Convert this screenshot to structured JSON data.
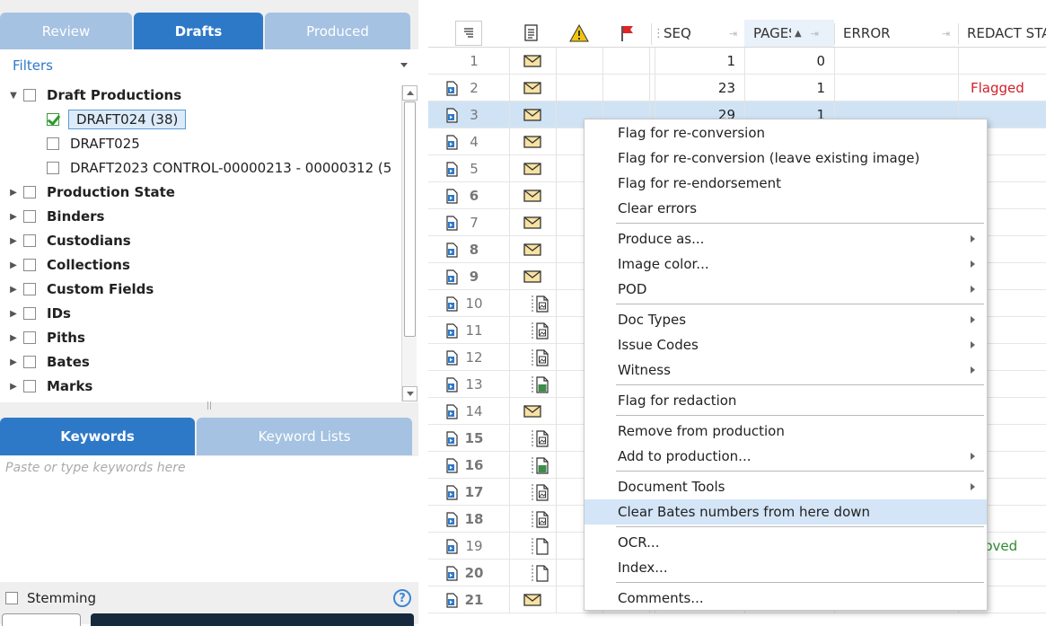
{
  "left_tabs": [
    {
      "label": "Review",
      "active": false
    },
    {
      "label": "Drafts",
      "active": true
    },
    {
      "label": "Produced",
      "active": false
    }
  ],
  "filters": {
    "label": "Filters",
    "tree": [
      {
        "label": "Draft Productions",
        "bold": true,
        "expander": "open",
        "checked": false
      },
      {
        "label": "DRAFT024 (38)",
        "bold": false,
        "checked": true,
        "selected": true
      },
      {
        "label": "DRAFT025",
        "bold": false,
        "checked": false
      },
      {
        "label": "DRAFT2023 CONTROL-00000213 - 00000312 (5",
        "bold": false,
        "checked": false
      },
      {
        "label": "Production State",
        "bold": true,
        "expander": "closed",
        "checked": false
      },
      {
        "label": "Binders",
        "bold": true,
        "expander": "closed",
        "checked": false
      },
      {
        "label": "Custodians",
        "bold": true,
        "expander": "closed",
        "checked": false
      },
      {
        "label": "Collections",
        "bold": true,
        "expander": "closed",
        "checked": false
      },
      {
        "label": "Custom Fields",
        "bold": true,
        "expander": "closed",
        "checked": false
      },
      {
        "label": "IDs",
        "bold": true,
        "expander": "closed",
        "checked": false
      },
      {
        "label": "Piths",
        "bold": true,
        "expander": "closed",
        "checked": false
      },
      {
        "label": "Bates",
        "bold": true,
        "expander": "closed",
        "checked": false
      },
      {
        "label": "Marks",
        "bold": true,
        "expander": "closed",
        "checked": false
      }
    ]
  },
  "keyword_tabs": [
    {
      "label": "Keywords",
      "active": true
    },
    {
      "label": "Keyword Lists",
      "active": false
    }
  ],
  "keywords": {
    "placeholder": "Paste or type keywords here"
  },
  "stemming": {
    "label": "Stemming",
    "checked": false
  },
  "help_icon": "?",
  "grid": {
    "columns": {
      "seq": "SEQ",
      "pages": "PAGES",
      "error": "ERROR",
      "redact": "REDACT STA"
    },
    "rows": [
      {
        "n": "1",
        "icon": "envelope",
        "doc": false,
        "bold": false,
        "seq": "1",
        "pages": "0",
        "redact": ""
      },
      {
        "n": "2",
        "icon": "envelope",
        "doc": true,
        "bold": false,
        "seq": "23",
        "pages": "1",
        "redact": "Flagged"
      },
      {
        "n": "3",
        "icon": "envelope",
        "doc": true,
        "bold": false,
        "seq": "29",
        "pages": "1",
        "redact": "",
        "selected": true
      },
      {
        "n": "4",
        "icon": "envelope",
        "doc": true,
        "bold": false,
        "seq": "",
        "pages": "",
        "redact": ""
      },
      {
        "n": "5",
        "icon": "envelope",
        "doc": true,
        "bold": false,
        "seq": "",
        "pages": "",
        "redact": ""
      },
      {
        "n": "6",
        "icon": "envelope",
        "doc": true,
        "bold": true,
        "seq": "",
        "pages": "",
        "redact": ""
      },
      {
        "n": "7",
        "icon": "envelope",
        "doc": true,
        "bold": false,
        "seq": "",
        "pages": "",
        "redact": ""
      },
      {
        "n": "8",
        "icon": "envelope",
        "doc": true,
        "bold": true,
        "seq": "",
        "pages": "",
        "redact": ""
      },
      {
        "n": "9",
        "icon": "envelope",
        "doc": true,
        "bold": true,
        "seq": "",
        "pages": "",
        "redact": ""
      },
      {
        "n": "10",
        "icon": "image-doc",
        "doc": true,
        "bold": false,
        "seq": "",
        "pages": "",
        "redact": ""
      },
      {
        "n": "11",
        "icon": "image-doc",
        "doc": true,
        "bold": false,
        "seq": "",
        "pages": "",
        "redact": ""
      },
      {
        "n": "12",
        "icon": "image-doc",
        "doc": true,
        "bold": false,
        "seq": "",
        "pages": "",
        "redact": ""
      },
      {
        "n": "13",
        "icon": "sheet-doc",
        "doc": true,
        "bold": false,
        "seq": "",
        "pages": "",
        "redact": ""
      },
      {
        "n": "14",
        "icon": "envelope",
        "doc": true,
        "bold": false,
        "seq": "",
        "pages": "",
        "redact": ""
      },
      {
        "n": "15",
        "icon": "image-doc",
        "doc": true,
        "bold": true,
        "seq": "",
        "pages": "",
        "redact": ""
      },
      {
        "n": "16",
        "icon": "sheet-doc",
        "doc": true,
        "bold": true,
        "seq": "",
        "pages": "",
        "redact": ""
      },
      {
        "n": "17",
        "icon": "image-doc",
        "doc": true,
        "bold": true,
        "seq": "",
        "pages": "",
        "redact": ""
      },
      {
        "n": "18",
        "icon": "image-doc",
        "doc": true,
        "bold": true,
        "seq": "",
        "pages": "",
        "redact": ""
      },
      {
        "n": "19",
        "icon": "blank-doc",
        "doc": true,
        "bold": false,
        "seq": "",
        "pages": "",
        "redact": "proved"
      },
      {
        "n": "20",
        "icon": "blank-doc",
        "doc": true,
        "bold": true,
        "seq": "",
        "pages": "",
        "redact": ""
      },
      {
        "n": "21",
        "icon": "envelope",
        "doc": true,
        "bold": true,
        "seq": "",
        "pages": "",
        "redact": ""
      }
    ]
  },
  "context_menu": {
    "items": [
      {
        "label": "Flag for re-conversion",
        "submenu": false,
        "sep_before": false
      },
      {
        "label": "Flag for re-conversion (leave existing image)",
        "submenu": false,
        "sep_before": false
      },
      {
        "label": "Flag for re-endorsement",
        "submenu": false,
        "sep_before": false
      },
      {
        "label": "Clear errors",
        "submenu": false,
        "sep_before": false
      },
      {
        "label": "Produce as...",
        "submenu": true,
        "sep_before": true
      },
      {
        "label": "Image color...",
        "submenu": true,
        "sep_before": false
      },
      {
        "label": "POD",
        "submenu": true,
        "sep_before": false
      },
      {
        "label": "Doc Types",
        "submenu": true,
        "sep_before": true
      },
      {
        "label": "Issue Codes",
        "submenu": true,
        "sep_before": false
      },
      {
        "label": "Witness",
        "submenu": true,
        "sep_before": false
      },
      {
        "label": "Flag for redaction",
        "submenu": false,
        "sep_before": true
      },
      {
        "label": "Remove from production",
        "submenu": false,
        "sep_before": true
      },
      {
        "label": "Add to production...",
        "submenu": true,
        "sep_before": false
      },
      {
        "label": "Document Tools",
        "submenu": true,
        "sep_before": true
      },
      {
        "label": "Clear Bates numbers from here down",
        "submenu": false,
        "sep_before": false,
        "highlighted": true
      },
      {
        "label": "OCR...",
        "submenu": false,
        "sep_before": true
      },
      {
        "label": "Index...",
        "submenu": false,
        "sep_before": false
      },
      {
        "label": "Comments...",
        "submenu": false,
        "sep_before": true
      }
    ]
  },
  "colors": {
    "accent": "#2e79c7",
    "tab_inactive": "#a5c2e2",
    "selected_row": "#cfe3f5",
    "flagged": "#d0202a",
    "approved": "#2e8b2e",
    "menu_highlight": "#d3e5f6"
  }
}
